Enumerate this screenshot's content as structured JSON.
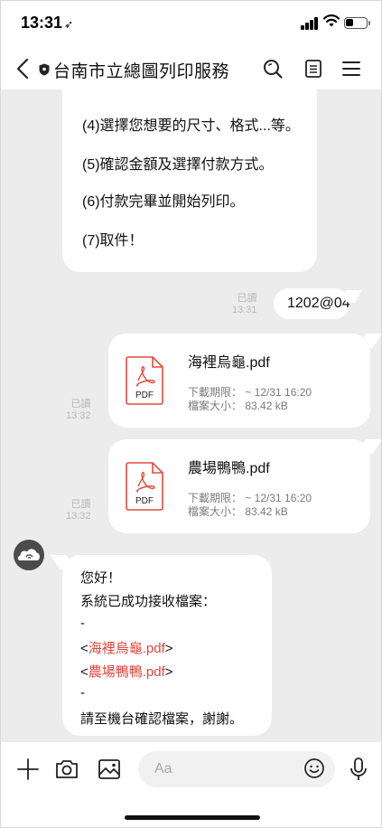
{
  "status_bar": {
    "time": "13:31",
    "location_glyph": "➶"
  },
  "header": {
    "title": "台南市立總圖列印服務"
  },
  "chat": {
    "instructions": [
      "(4)選擇您想要的尺寸、格式...等。",
      "(5)確認金額及選擇付款方式。",
      "(6)付款完畢並開始列印。",
      "(7)取件！"
    ],
    "sent_text": {
      "read_label": "已讀",
      "time": "13:31",
      "text": "1202@04"
    },
    "files": [
      {
        "name": "海裡烏龜.pdf",
        "pdf_label": "PDF",
        "expiry": "下載期限： ~ 12/31 16:20",
        "size": "檔案大小： 83.42 kB",
        "read_label": "已讀",
        "time": "13:32"
      },
      {
        "name": "農場鴨鴨.pdf",
        "pdf_label": "PDF",
        "expiry": "下載期限： ~ 12/31 16:20",
        "size": "檔案大小： 83.42 kB",
        "read_label": "已讀",
        "time": "13:32"
      }
    ],
    "reply": {
      "line1": "您好！",
      "line2": "系統已成功接收檔案：",
      "dash1": "-",
      "file1_open": "<",
      "file1_name": "海裡烏龜.pdf",
      "file1_close": ">",
      "file2_open": "<",
      "file2_name": "農場鴨鴨.pdf",
      "file2_close": ">",
      "dash2": "-",
      "line3": "請至機台確認檔案，謝謝。"
    }
  },
  "input": {
    "placeholder": "Aa"
  },
  "colors": {
    "chat_bg": "#ececec",
    "link_red": "#e0463c",
    "pdf_red": "#e64a3d"
  }
}
